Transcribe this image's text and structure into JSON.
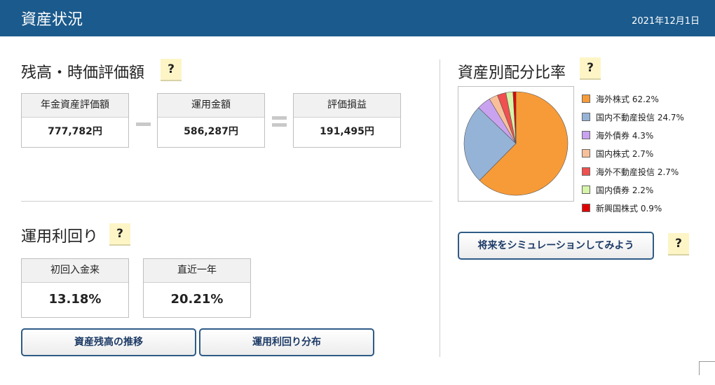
{
  "header": {
    "title": "資産状況",
    "date": "2021年12月1日"
  },
  "help_label": "?",
  "balance": {
    "title": "残高・時価評価額",
    "boxes": [
      {
        "label": "年金資産評価額",
        "value": "777,782円"
      },
      {
        "label": "運用金額",
        "value": "586,287円"
      },
      {
        "label": "評価損益",
        "value": "191,495円"
      }
    ]
  },
  "yield": {
    "title": "運用利回り",
    "boxes": [
      {
        "label": "初回入金来",
        "value": "13.18%"
      },
      {
        "label": "直近一年",
        "value": "20.21%"
      }
    ]
  },
  "buttons": {
    "history": "資産残高の推移",
    "distribution": "運用利回り分布",
    "simulate": "将来をシミュレーションしてみよう"
  },
  "allocation": {
    "title": "資産別配分比率",
    "chart_data": {
      "type": "pie",
      "slices": [
        {
          "label": "海外株式",
          "value": 62.2,
          "text": "海外株式 62.2%",
          "color": "#f79b38"
        },
        {
          "label": "国内不動産投信",
          "value": 24.7,
          "text": "国内不動産投信 24.7%",
          "color": "#95b3d7"
        },
        {
          "label": "海外債券",
          "value": 4.3,
          "text": "海外債券 4.3%",
          "color": "#c9a3f0"
        },
        {
          "label": "国内株式",
          "value": 2.7,
          "text": "国内株式 2.7%",
          "color": "#f8c09a"
        },
        {
          "label": "海外不動産投信",
          "value": 2.7,
          "text": "海外不動産投信 2.7%",
          "color": "#f0504f"
        },
        {
          "label": "国内債券",
          "value": 2.2,
          "text": "国内債券 2.2%",
          "color": "#d6f5a8"
        },
        {
          "label": "新興国株式",
          "value": 0.9,
          "text": "新興国株式 0.9%",
          "color": "#e00000"
        }
      ]
    }
  }
}
